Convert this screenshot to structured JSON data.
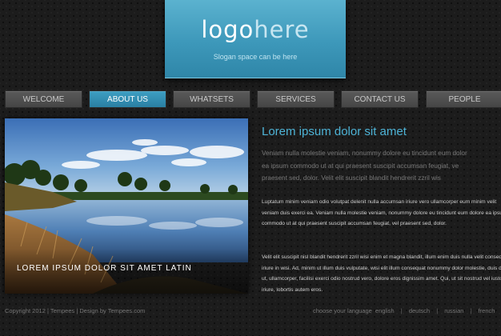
{
  "logo": {
    "text_main": "logo",
    "text_light": "here",
    "slogan": "Slogan space can be here"
  },
  "nav": {
    "items": [
      {
        "label": "WELCOME",
        "active": false
      },
      {
        "label": "ABOUT US",
        "active": true
      },
      {
        "label": "WHATSETS",
        "active": false
      },
      {
        "label": "SERVICES",
        "active": false
      },
      {
        "label": "CONTACT US",
        "active": false
      },
      {
        "label": "PEOPLE",
        "active": false
      }
    ]
  },
  "photo": {
    "caption": "LOREM IPSUM DOLOR SIT AMET LATIN"
  },
  "content": {
    "heading": "Lorem ipsum dolor sit amet",
    "intro_lines": [
      "Veniam nulla molestie veniam, nonummy dolore eu tincidunt eum dolor",
      "ea ipsum commodo ut at qui praesent suscipit accumsan feugiat, ve",
      "praesent sed, dolor. Velit elit suscipit blandit hendrerit zzril wis"
    ],
    "paragraph1": "Luptatum minim veniam odio volutpat delenit nulla accumsan iriure vero ullamcorper eum minim velit veniam duis exerci ea. Veniam nulla molestie veniam, nonummy dolore eu tincidunt eum dolore ea ipsum commodo ut at qui praesent suscipit accumsan feugiat, vel praesent sed, dolor.",
    "paragraph2": "Velit elit suscipit nisl blandit hendrerit zzril wisi enim et magna blandit, illum enim duis nulla velit consequat iriure in wisi. Ad, minim ut illum duis vulputate, wisi elit illum consequat nonummy dolor molestie, duis duis ut, ullamcorper, facilisi exerci odio nostrud vero, dolore eros dignissim amet. Qui, ut sit nostrud vel iusto, iriure, lobortis autem eros."
  },
  "footer": {
    "copyright": "Copyright 2012 | Tempees | Design by Tempees.com",
    "language_label": "choose your language",
    "languages": [
      "english",
      "deutsch",
      "russian",
      "french"
    ]
  },
  "colors": {
    "accent": "#4db3d6",
    "nav_active": "#3e9fc3",
    "background": "#1c1c1c"
  }
}
